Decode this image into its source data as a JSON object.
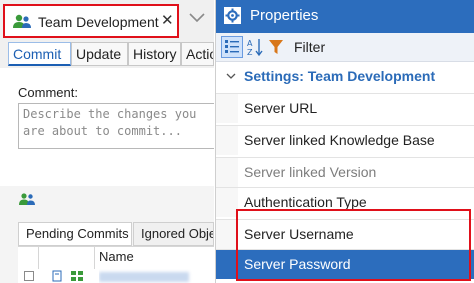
{
  "left_panel": {
    "doc_tab": {
      "title": "Team Development",
      "close_glyph": "✕",
      "icon": "team-users-icon"
    },
    "tab_strip_chevron_icon": "chevron-down-icon",
    "subtabs": [
      {
        "label": "Commit",
        "selected": true
      },
      {
        "label": "Update",
        "selected": false
      },
      {
        "label": "History",
        "selected": false
      },
      {
        "label": "Actions",
        "selected": false
      }
    ],
    "comment": {
      "label": "Comment:",
      "placeholder": "Describe the changes you are about to commit..."
    },
    "commit_tabs": [
      {
        "label": "Pending Commits",
        "selected": true
      },
      {
        "label": "Ignored Objects",
        "selected": false
      }
    ],
    "grid": {
      "columns": [
        "Name"
      ]
    }
  },
  "properties": {
    "title": "Properties",
    "toolbar": {
      "filter_label": "Filter",
      "icons": [
        "categorized-view-icon",
        "alphabetical-sort-icon",
        "filter-funnel-icon"
      ]
    },
    "category": "Settings: Team Development",
    "rows": [
      {
        "label": "Server URL",
        "enabled": true,
        "selected": false
      },
      {
        "label": "Server linked Knowledge Base",
        "enabled": true,
        "selected": false
      },
      {
        "label": "Server linked Version",
        "enabled": false,
        "selected": false
      },
      {
        "label": "Authentication Type",
        "enabled": true,
        "selected": false
      },
      {
        "label": "Server Username",
        "enabled": true,
        "selected": false
      },
      {
        "label": "Server Password",
        "enabled": true,
        "selected": true
      }
    ]
  },
  "colors": {
    "accent_blue": "#2c6dbd",
    "highlight_red": "#e0101a",
    "category_text": "#2b6bb8"
  }
}
